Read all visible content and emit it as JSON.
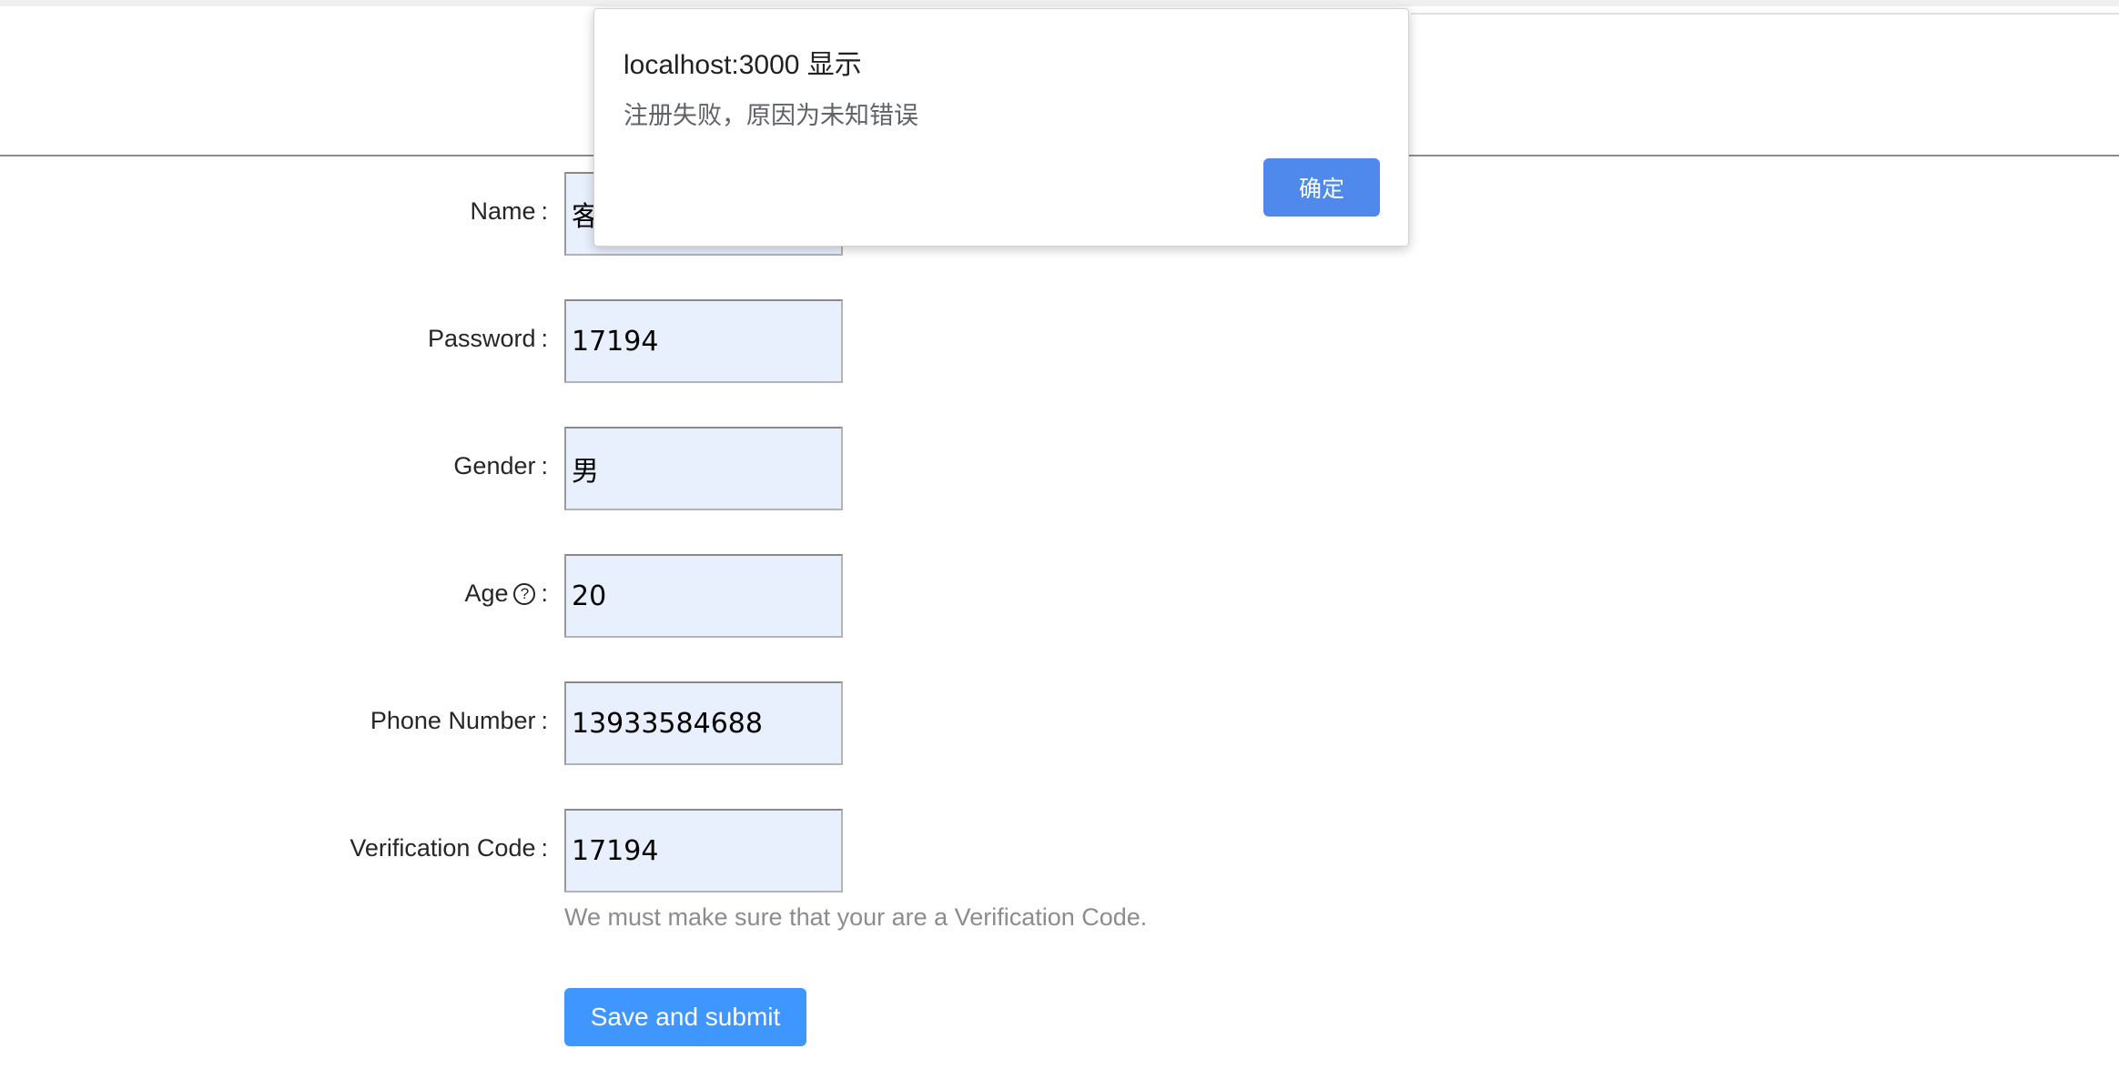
{
  "form": {
    "fields": [
      {
        "label": "Name",
        "value": "客"
      },
      {
        "label": "Password",
        "value": "17194"
      },
      {
        "label": "Gender",
        "value": "男"
      },
      {
        "label": "Age",
        "value": "20"
      },
      {
        "label": "Phone Number",
        "value": "13933584688"
      },
      {
        "label": "Verification Code",
        "value": "17194"
      }
    ],
    "colon": ":",
    "age_help_icon": "?",
    "verification_help": "We must make sure that your are a Verification Code.",
    "submit_label": "Save and submit"
  },
  "dialog": {
    "title": "localhost:3000 显示",
    "message": "注册失败，原因为未知错误",
    "ok_label": "确定"
  },
  "colors": {
    "primary": "#4096ff",
    "dialog_button": "#5089ec",
    "input_autofill_bg": "#e8f0fe",
    "help_text": "#8c8c8c"
  }
}
